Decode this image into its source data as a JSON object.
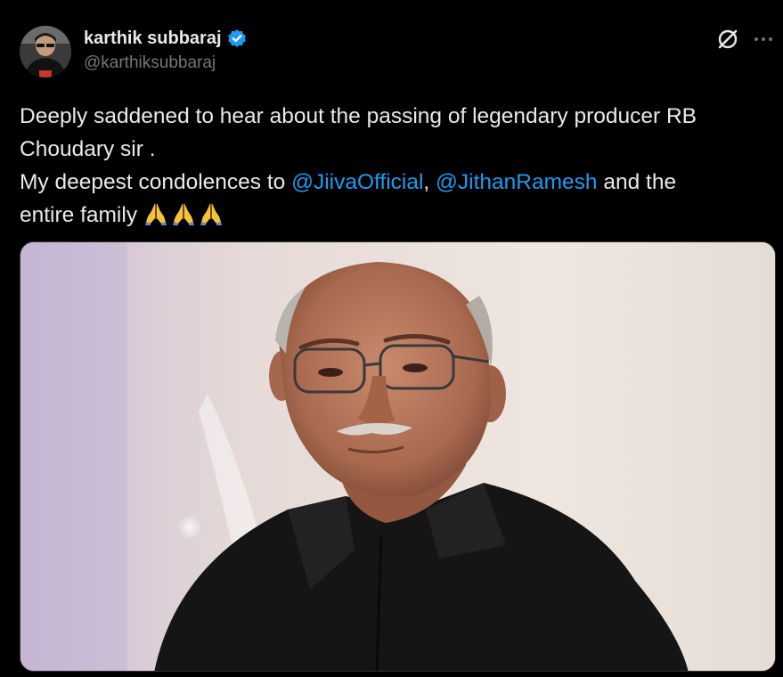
{
  "tweet": {
    "author": {
      "display_name": "karthik subbaraj",
      "handle": "@karthiksubbaraj",
      "verified_icon": "verified-badge-icon",
      "badge_color": "#1d9bf0"
    },
    "actions": {
      "grok_icon": "grok-icon",
      "more_icon": "more-dots-icon"
    },
    "text": {
      "line1": "Deeply saddened to hear about the passing of legendary producer RB",
      "line2": "Choudary sir .",
      "line3_prefix": "My deepest condolences to ",
      "mention1": "@JiivaOfficial",
      "separator": ", ",
      "mention2": "@JithanRamesh",
      "line3_suffix": " and the",
      "line4": "entire family",
      "emoji": [
        "folded-hands-icon",
        "folded-hands-icon",
        "folded-hands-icon"
      ]
    },
    "media": {
      "type": "photo",
      "subject": "portrait-photo"
    },
    "colors": {
      "background": "#000000",
      "text": "#e7e9ea",
      "secondary": "#71767b",
      "link": "#1d9bf0"
    }
  }
}
